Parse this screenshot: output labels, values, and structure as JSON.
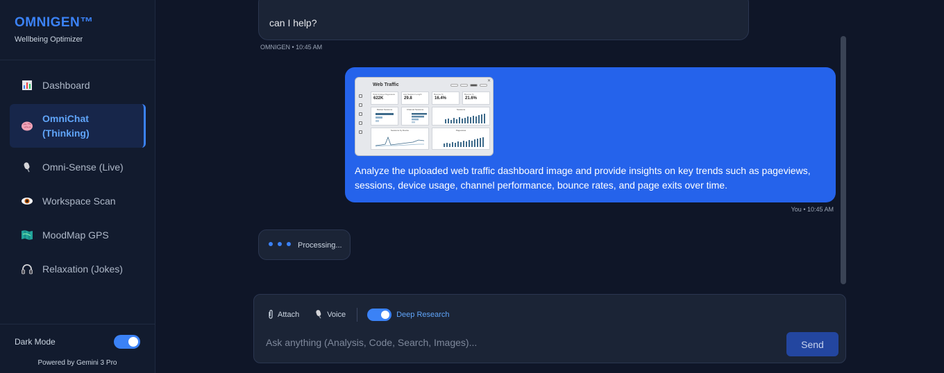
{
  "sidebar": {
    "brand": "OMNIGEN™",
    "subtitle": "Wellbeing Optimizer",
    "items": [
      {
        "label": "Dashboard",
        "icon": "bar-chart-icon"
      },
      {
        "label": "OmniChat (Thinking)",
        "icon": "brain-icon"
      },
      {
        "label": "Omni-Sense (Live)",
        "icon": "microphone-icon"
      },
      {
        "label": "Workspace Scan",
        "icon": "eye-icon"
      },
      {
        "label": "MoodMap GPS",
        "icon": "map-icon"
      },
      {
        "label": "Relaxation (Jokes)",
        "icon": "headphones-icon"
      }
    ],
    "dark_mode_label": "Dark Mode",
    "dark_mode_on": true,
    "powered_by": "Powered by Gemini 3 Pro"
  },
  "chat": {
    "ai_message_tail": "can I help?",
    "ai_meta": "OMNIGEN • 10:45 AM",
    "user_message": "Analyze the uploaded web traffic dashboard image and provide insights on key trends such as pageviews, sessions, device usage, channel performance, bounce rates, and page exits over time.",
    "user_meta": "You • 10:45 AM",
    "attachment": {
      "title": "Web Traffic",
      "kpis": [
        {
          "label": "Total Unique Pageviews",
          "value": "622K"
        },
        {
          "label": "Avg Session Length",
          "value": "29.8"
        },
        {
          "label": "Bounce %",
          "value": "16.4%"
        },
        {
          "label": "Bounce %",
          "value": "21.6%"
        }
      ],
      "panels": [
        "Market Sessions",
        "Channel Sessions",
        "Sessions",
        "Sessions by Device",
        "Pageviews"
      ]
    },
    "processing": "Processing..."
  },
  "composer": {
    "attach_label": "Attach",
    "voice_label": "Voice",
    "deep_research_label": "Deep Research",
    "deep_research_on": true,
    "placeholder": "Ask anything (Analysis, Code, Search, Images)...",
    "send_label": "Send"
  },
  "colors": {
    "accent": "#3b82f6",
    "user_bubble": "#2563eb",
    "background": "#0f1628"
  }
}
